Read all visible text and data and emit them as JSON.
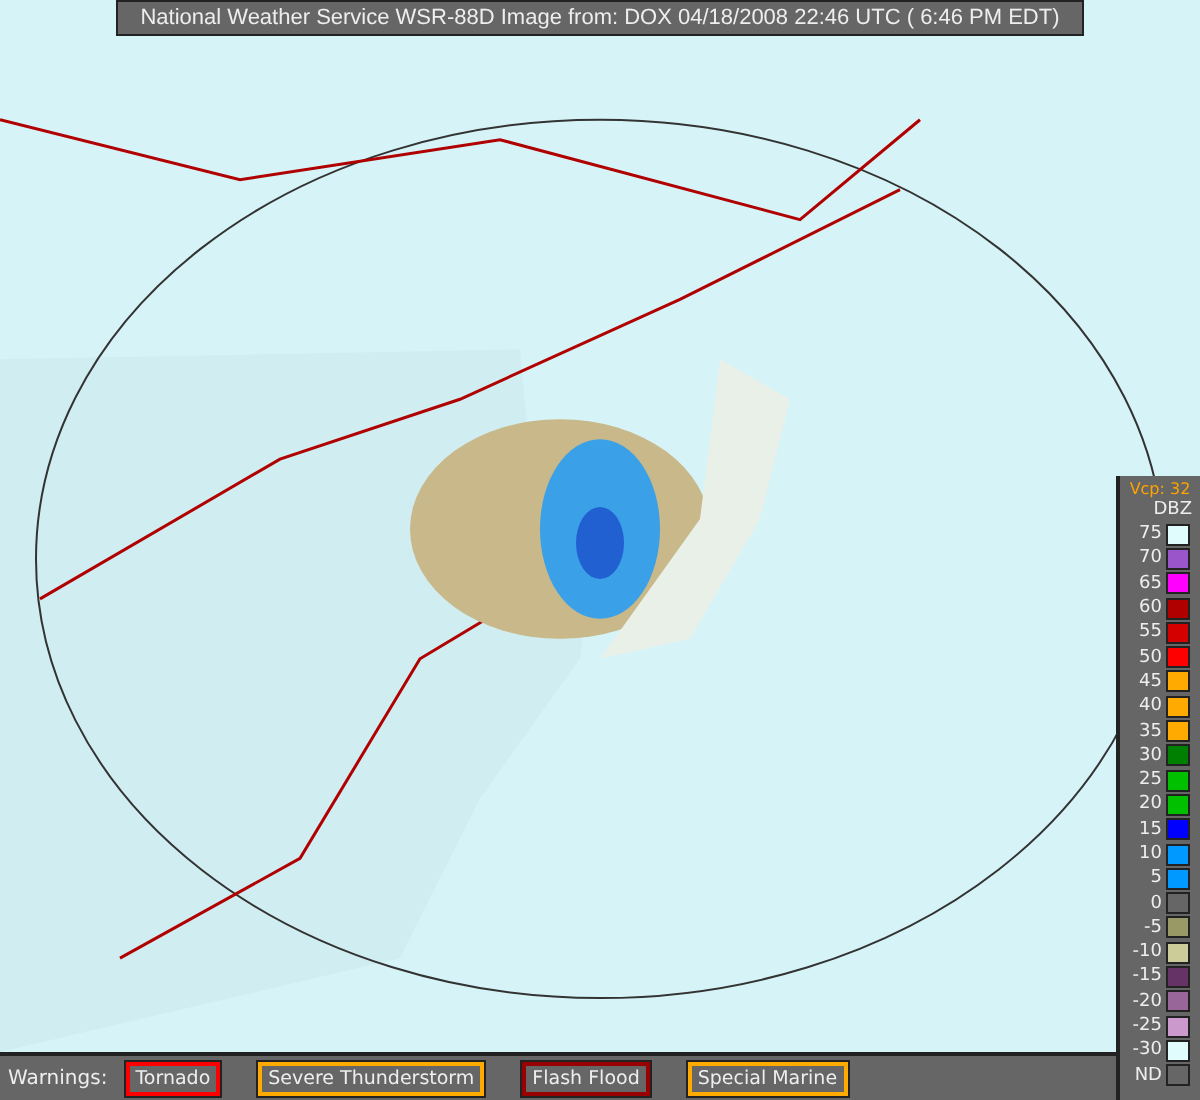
{
  "title": "National Weather Service WSR-88D Image from: DOX 04/18/2008 22:46 UTC ( 6:46 PM EDT)",
  "legend": {
    "vcp": "Vcp: 32",
    "unit": "DBZ",
    "items": [
      {
        "label": "75",
        "color": "#e0fcfc"
      },
      {
        "label": "70",
        "color": "#9955c9"
      },
      {
        "label": "65",
        "color": "#ff00ff"
      },
      {
        "label": "60",
        "color": "#b00000"
      },
      {
        "label": "55",
        "color": "#d40000"
      },
      {
        "label": "50",
        "color": "#ff0000"
      },
      {
        "label": "45",
        "color": "#ffaa00"
      },
      {
        "label": "40",
        "color": "#ffaa00"
      },
      {
        "label": "35",
        "color": "#ffaa00"
      },
      {
        "label": "30",
        "color": "#008000"
      },
      {
        "label": "25",
        "color": "#00c000"
      },
      {
        "label": "20",
        "color": "#00c000"
      },
      {
        "label": "15",
        "color": "#0000ff"
      },
      {
        "label": "10",
        "color": "#0099ff"
      },
      {
        "label": "5",
        "color": "#0099ff"
      },
      {
        "label": "0",
        "color": "#666666"
      },
      {
        "label": "-5",
        "color": "#999966"
      },
      {
        "label": "-10",
        "color": "#cccc99"
      },
      {
        "label": "-15",
        "color": "#663366"
      },
      {
        "label": "-20",
        "color": "#996699"
      },
      {
        "label": "-25",
        "color": "#cc99cc"
      },
      {
        "label": "-30",
        "color": "#e0fcfc"
      },
      {
        "label": "ND",
        "color": "#666666"
      }
    ]
  },
  "warnings": {
    "label": "Warnings:",
    "items": [
      {
        "label": "Tornado",
        "color": "#ff0000"
      },
      {
        "label": "Severe Thunderstorm",
        "color": "#ffaa00"
      },
      {
        "label": "Flash Flood",
        "color": "#990000"
      },
      {
        "label": "Special Marine",
        "color": "#ffaa00"
      }
    ]
  }
}
